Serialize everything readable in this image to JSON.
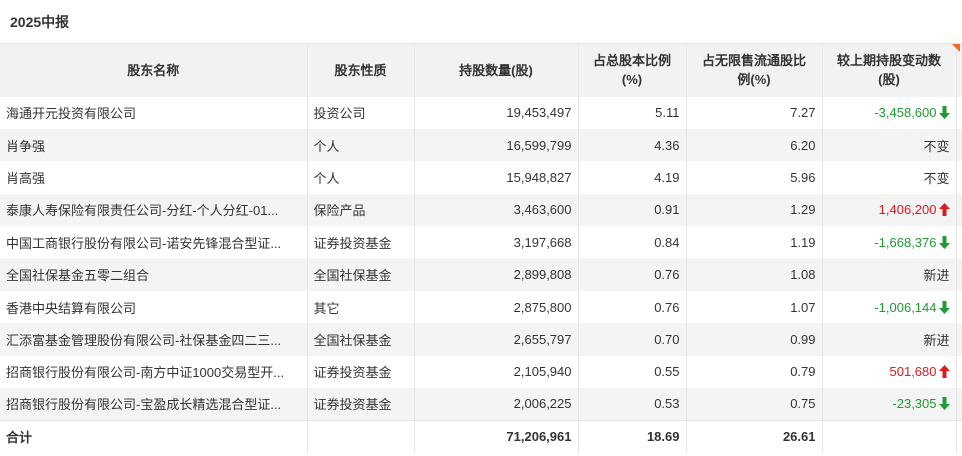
{
  "section_title": "2025中报",
  "colors": {
    "up": "#e0191a",
    "down": "#1f9b34",
    "header_bg": "#f2f2f2",
    "stripe_bg": "#f4f4f4",
    "flag": "#f26b21"
  },
  "table": {
    "headers": {
      "name": "股东名称",
      "type": "股东性质",
      "shares": "持股数量(股)",
      "pct_total_l1": "占总股本比例",
      "pct_total_l2": "(%)",
      "pct_float_l1": "占无限售流通股比",
      "pct_float_l2": "例(%)",
      "change_l1": "较上期持股变动数",
      "change_l2": "(股)"
    },
    "rows": [
      {
        "name": "海通开元投资有限公司",
        "type": "投资公司",
        "shares": "19,453,497",
        "pct_total": "5.11",
        "pct_float": "7.27",
        "change": "-3,458,600",
        "dir": "down"
      },
      {
        "name": "肖争强",
        "type": "个人",
        "shares": "16,599,799",
        "pct_total": "4.36",
        "pct_float": "6.20",
        "change": "不变",
        "dir": "none"
      },
      {
        "name": "肖高强",
        "type": "个人",
        "shares": "15,948,827",
        "pct_total": "4.19",
        "pct_float": "5.96",
        "change": "不变",
        "dir": "none"
      },
      {
        "name": "泰康人寿保险有限责任公司-分红-个人分红-01...",
        "type": "保险产品",
        "shares": "3,463,600",
        "pct_total": "0.91",
        "pct_float": "1.29",
        "change": "1,406,200",
        "dir": "up"
      },
      {
        "name": "中国工商银行股份有限公司-诺安先锋混合型证...",
        "type": "证券投资基金",
        "shares": "3,197,668",
        "pct_total": "0.84",
        "pct_float": "1.19",
        "change": "-1,668,376",
        "dir": "down"
      },
      {
        "name": "全国社保基金五零二组合",
        "type": "全国社保基金",
        "shares": "2,899,808",
        "pct_total": "0.76",
        "pct_float": "1.08",
        "change": "新进",
        "dir": "none"
      },
      {
        "name": "香港中央结算有限公司",
        "type": "其它",
        "shares": "2,875,800",
        "pct_total": "0.76",
        "pct_float": "1.07",
        "change": "-1,006,144",
        "dir": "down"
      },
      {
        "name": "汇添富基金管理股份有限公司-社保基金四二三...",
        "type": "全国社保基金",
        "shares": "2,655,797",
        "pct_total": "0.70",
        "pct_float": "0.99",
        "change": "新进",
        "dir": "none"
      },
      {
        "name": "招商银行股份有限公司-南方中证1000交易型开...",
        "type": "证券投资基金",
        "shares": "2,105,940",
        "pct_total": "0.55",
        "pct_float": "0.79",
        "change": "501,680",
        "dir": "up"
      },
      {
        "name": "招商银行股份有限公司-宝盈成长精选混合型证...",
        "type": "证券投资基金",
        "shares": "2,006,225",
        "pct_total": "0.53",
        "pct_float": "0.75",
        "change": "-23,305",
        "dir": "down"
      }
    ],
    "total": {
      "label": "合计",
      "shares": "71,206,961",
      "pct_total": "18.69",
      "pct_float": "26.61"
    }
  }
}
